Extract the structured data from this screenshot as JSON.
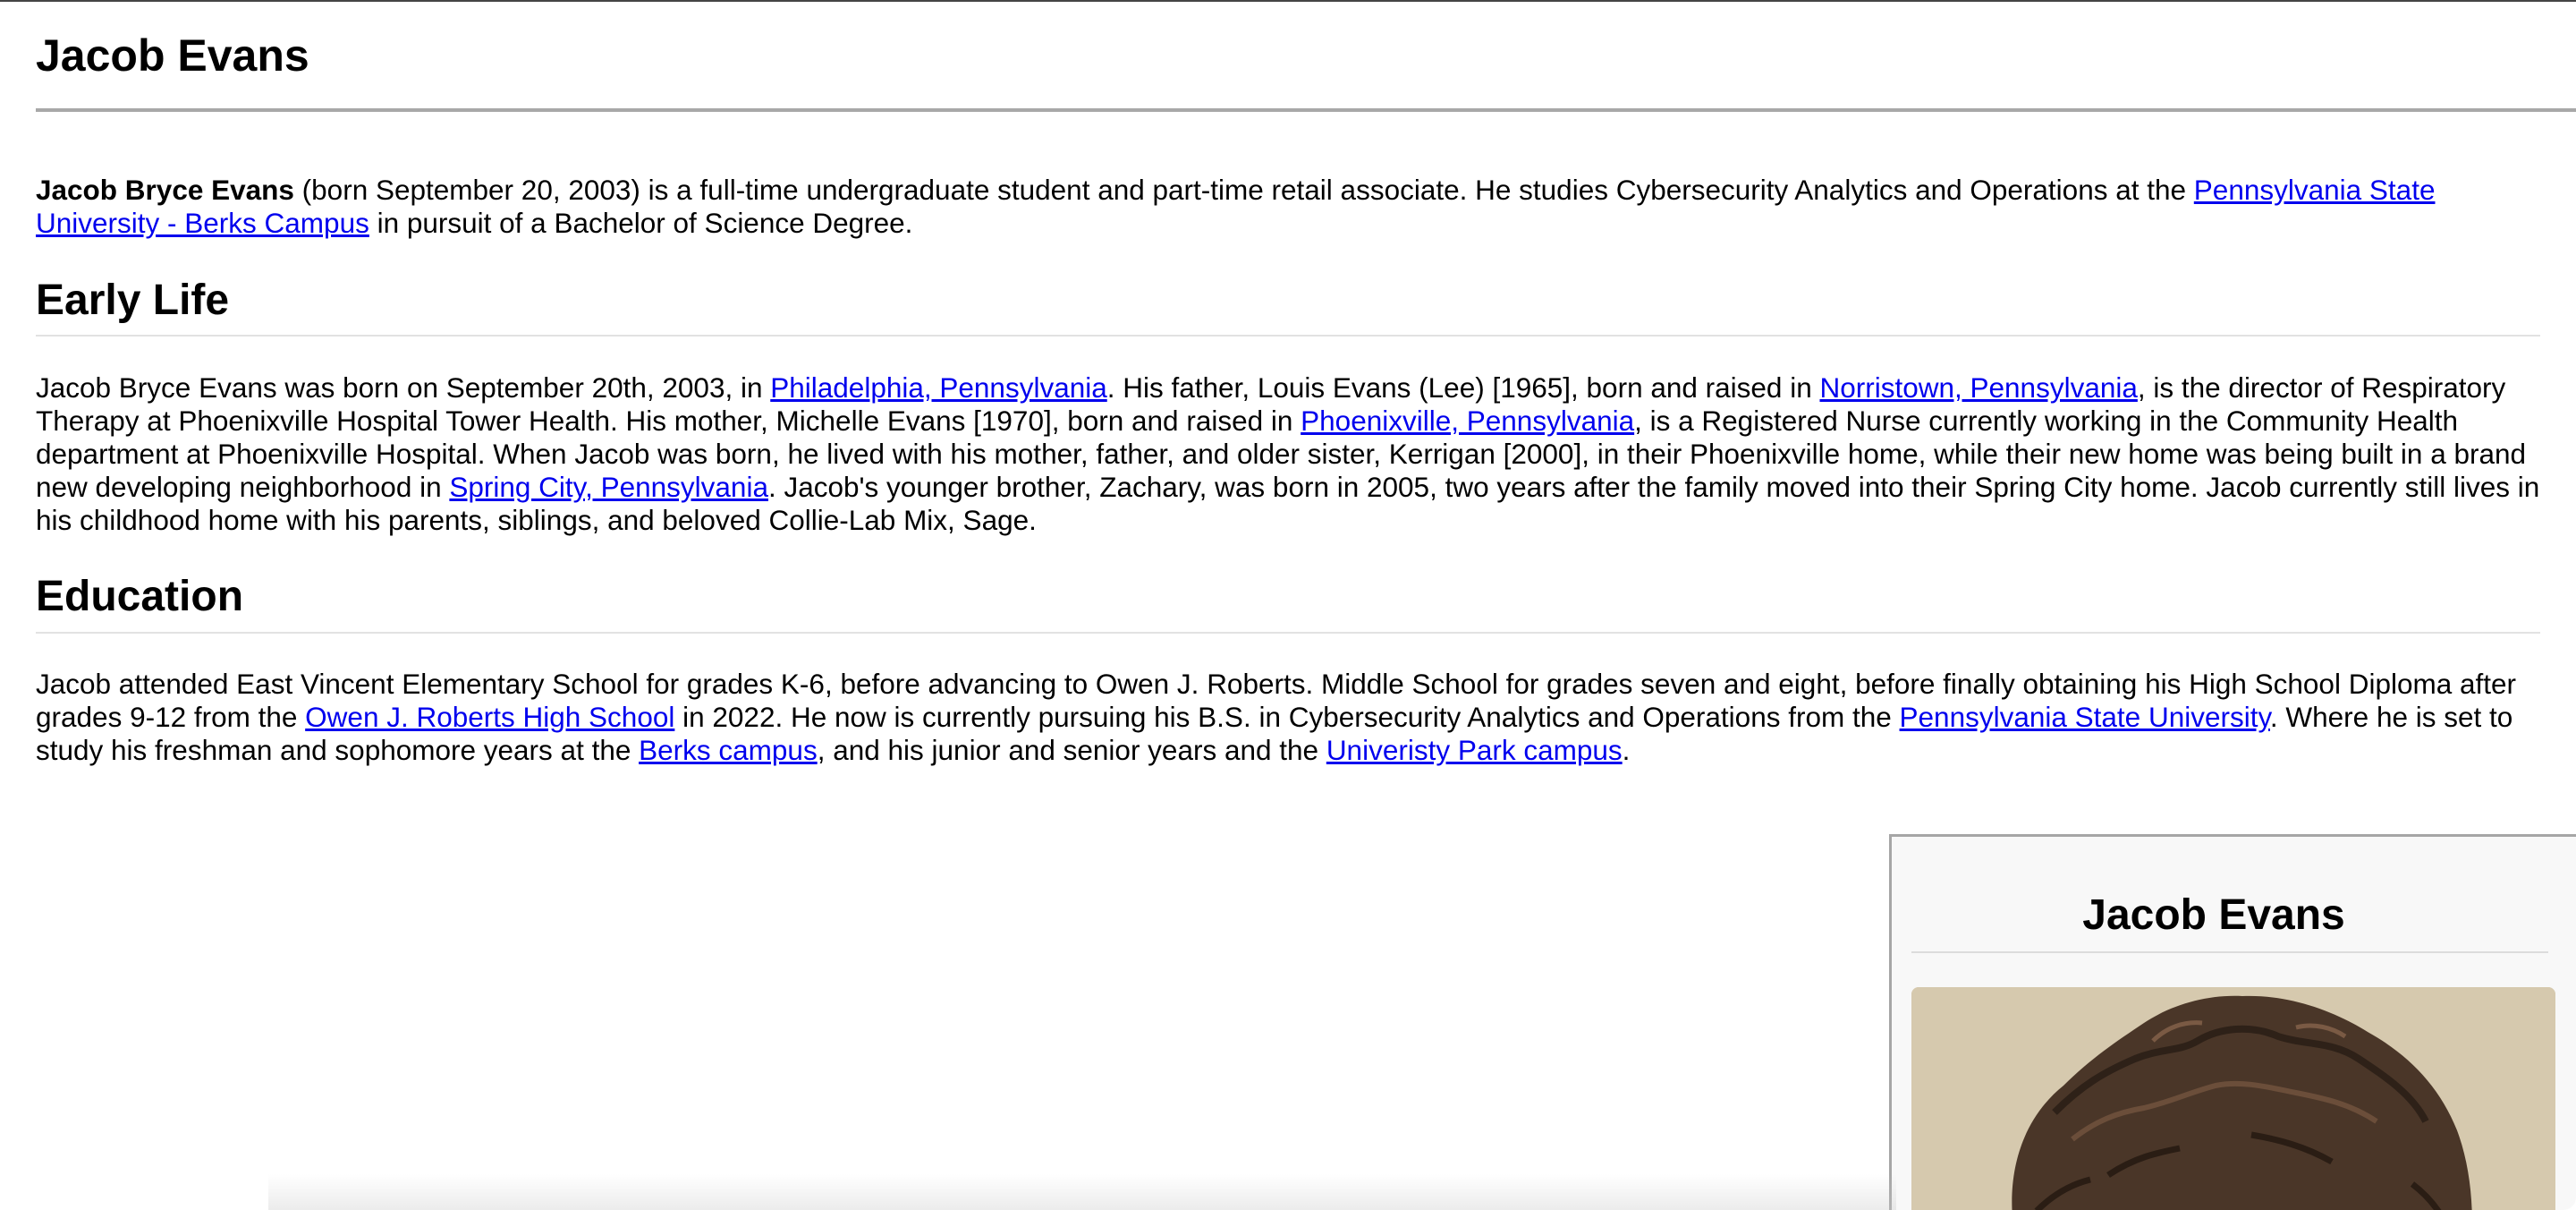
{
  "page": {
    "title": "Jacob Evans"
  },
  "intro": {
    "bold_name": "Jacob Bryce Evans",
    "text_1": " (born September 20, 2003) is a full-time undergraduate student and part-time retail associate. He studies Cybersecurity Analytics and Operations at the ",
    "link_1": "Pennsylvania State University - Berks Campus",
    "text_2": " in pursuit of a Bachelor of Science Degree."
  },
  "early_life": {
    "heading": "Early Life",
    "t1": "Jacob Bryce Evans was born on September 20th, 2003, in ",
    "link_philadelphia": "Philadelphia, Pennsylvania",
    "t2": ". His father, Louis Evans (Lee) [1965], born and raised in ",
    "link_norristown": "Norristown, Pennsylvania",
    "t3": ", is the director of Respiratory Therapy at Phoenixville Hospital Tower Health. His mother, Michelle Evans [1970], born and raised in ",
    "link_phoenixville": "Phoenixville, Pennsylvania",
    "t4": ", is a Registered Nurse currently working in the Community Health department at Phoenixville Hospital. When Jacob was born, he lived with his mother, father, and older sister, Kerrigan [2000], in their Phoenixville home, while their new home was being built in a brand new developing neighborhood in ",
    "link_spring_city": "Spring City, Pennsylvania",
    "t5": ". Jacob's younger brother, Zachary, was born in 2005, two years after the family moved into their Spring City home. Jacob currently still lives in his childhood home with his parents, siblings, and beloved Collie-Lab Mix, Sage."
  },
  "education": {
    "heading": "Education",
    "t1": "Jacob attended East Vincent Elementary School for grades K-6, before advancing to Owen J. Roberts. Middle School for grades seven and eight, before finally obtaining his High School Diploma after grades 9-12 from the ",
    "link_ojr": "Owen J. Roberts High School",
    "t2": " in 2022. He now is currently pursuing his B.S. in Cybersecurity Analytics and Operations from the ",
    "link_psu": "Pennsylvania State University",
    "t3": ". Where he is set to study his freshman and sophomore years at the ",
    "link_berks": "Berks campus",
    "t4": ", and his junior and senior years and the ",
    "link_up": "Univeristy Park campus",
    "t5": "."
  },
  "infobox": {
    "title": "Jacob Evans",
    "photo_icon": "portrait-photo"
  },
  "colors": {
    "link": "#0000ee",
    "rule": "#a8a8a8",
    "infobox_bg": "#f8f8f8"
  }
}
